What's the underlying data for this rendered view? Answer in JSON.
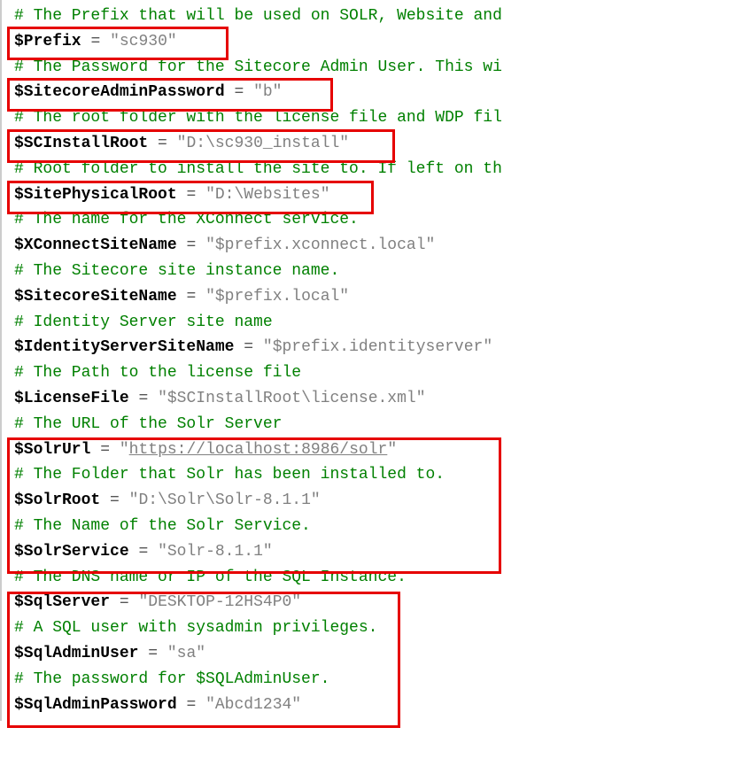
{
  "lines": {
    "c1": "# The Prefix that will be used on SOLR, Website and",
    "c2": "# The Password for the Sitecore Admin User. This wi",
    "c3": "# The root folder with the license file and WDP fil",
    "c4": "# Root folder to install the site to. If left on th",
    "c5": "# The name for the XConnect service.",
    "c6": "# The Sitecore site instance name.",
    "c7": "# Identity Server site name",
    "c8": "# The Path to the license file",
    "c9": "# The URL of the Solr Server",
    "c10": "# The Folder that Solr has been installed to.",
    "c11": "# The Name of the Solr Service.",
    "c12": "# The DNS name or IP of the SQL Instance.",
    "c13": "# A SQL user with sysadmin privileges.",
    "c14": "# The password for $SQLAdminUser."
  },
  "vars": {
    "prefix": {
      "name": "$Prefix",
      "eq": "=",
      "val": "\"sc930\""
    },
    "adminPw": {
      "name": "$SitecoreAdminPassword",
      "eq": "=",
      "val": "\"b\""
    },
    "installRoot": {
      "name": "$SCInstallRoot",
      "eq": "=",
      "val": "\"D:\\sc930_install\""
    },
    "physRoot": {
      "name": "$SitePhysicalRoot",
      "eq": "=",
      "val": "\"D:\\Websites\""
    },
    "xconnect": {
      "name": "$XConnectSiteName",
      "eq": "=",
      "val": "\"$prefix.xconnect.local\""
    },
    "siteName": {
      "name": "$SitecoreSiteName",
      "eq": "=",
      "val": "\"$prefix.local\""
    },
    "idServer": {
      "name": "$IdentityServerSiteName",
      "eq": "=",
      "val": "\"$prefix.identityserver\""
    },
    "license": {
      "name": "$LicenseFile",
      "eq": "=",
      "val": "\"$SCInstallRoot\\license.xml\""
    },
    "solrUrl": {
      "name": "$SolrUrl",
      "eq": "=",
      "valOpen": "\"",
      "valUrl": "https://localhost:8986/solr",
      "valClose": "\""
    },
    "solrRoot": {
      "name": "$SolrRoot",
      "eq": "=",
      "val": "\"D:\\Solr\\Solr-8.1.1\""
    },
    "solrService": {
      "name": "$SolrService",
      "eq": "=",
      "val": "\"Solr-8.1.1\""
    },
    "sqlServer": {
      "name": "$SqlServer",
      "eq": "=",
      "val": "\"DESKTOP-12HS4P0\""
    },
    "sqlUser": {
      "name": "$SqlAdminUser",
      "eq": "=",
      "val": "\"sa\""
    },
    "sqlPw": {
      "name": "$SqlAdminPassword",
      "eq": "=",
      "val": "\"Abcd1234\""
    }
  }
}
